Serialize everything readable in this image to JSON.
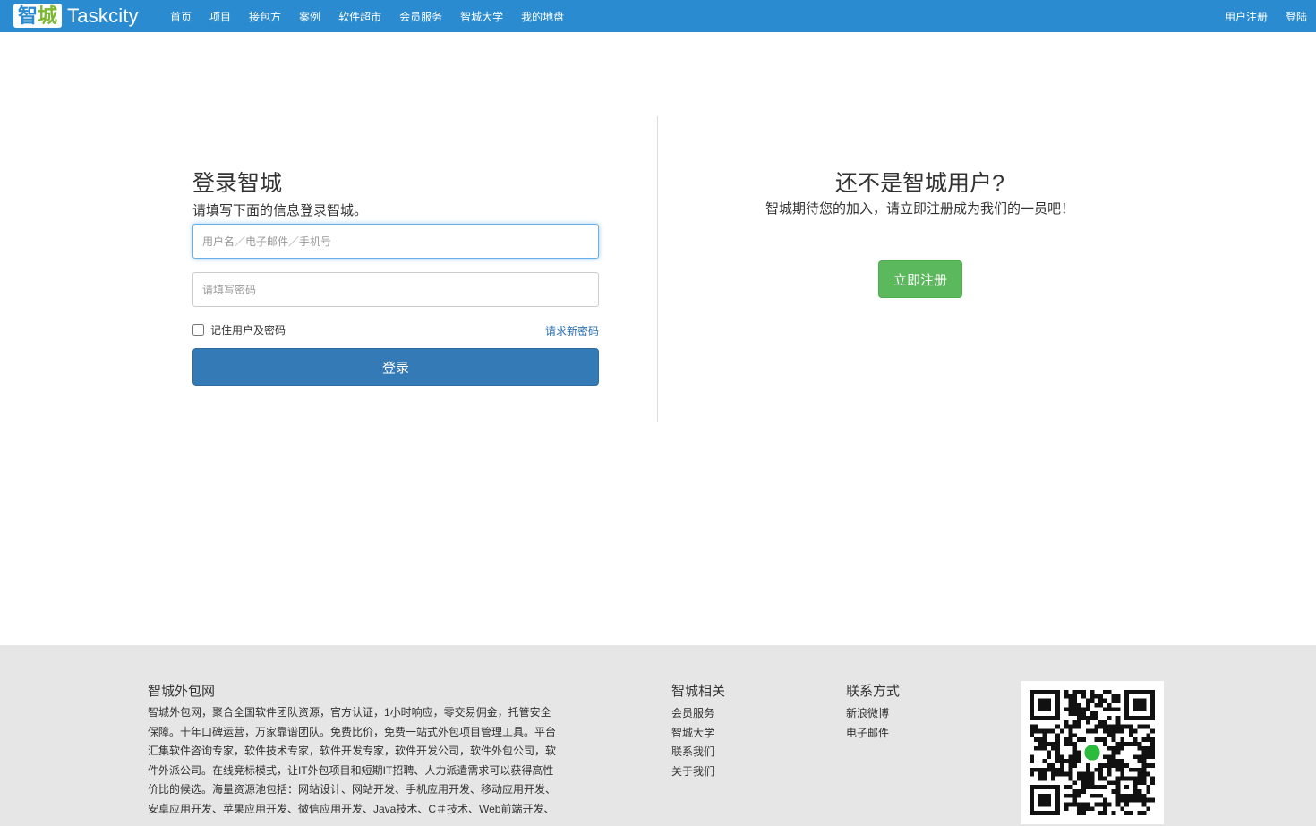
{
  "nav": {
    "logo_char1": "智",
    "logo_char2": "城",
    "logo_text": "Taskcity",
    "links": [
      "首页",
      "项目",
      "接包方",
      "案例",
      "软件超市",
      "会员服务",
      "智城大学",
      "我的地盘"
    ],
    "register": "用户注册",
    "login": "登陆"
  },
  "login": {
    "title": "登录智城",
    "subtitle": "请填写下面的信息登录智城。",
    "username_placeholder": "用户名／电子邮件／手机号",
    "password_placeholder": "请填写密码",
    "remember_label": "记住用户及密码",
    "forgot_link": "请求新密码",
    "submit": "登录"
  },
  "register": {
    "title": "还不是智城用户?",
    "subtitle": "智城期待您的加入，请立即注册成为我们的一员吧！",
    "button": "立即注册"
  },
  "footer": {
    "about_title": "智城外包网",
    "about_text": "智城外包网，聚合全国软件团队资源，官方认证，1小时响应，零交易佣金，托管安全保障。十年口碑运营，万家靠谱团队。免费比价，免费一站式外包项目管理工具。平台汇集软件咨询专家，软件技术专家，软件开发专家，软件开发公司，软件外包公司，软件外派公司。在线竞标模式，让IT外包项目和短期IT招聘、人力派遣需求可以获得高性价比的候选。海量资源池包括：网站设计、网站开发、手机应用开发、移动应用开发、安卓应用开发、苹果应用开发、微信应用开发、Java技术、C＃技术、Web前端开发、",
    "related_title": "智城相关",
    "related_links": [
      "会员服务",
      "智城大学",
      "联系我们",
      "关于我们"
    ],
    "contact_title": "联系方式",
    "contact_links": [
      "新浪微博",
      "电子邮件"
    ]
  },
  "colors": {
    "nav_bg": "#2a8bd0",
    "primary_btn": "#337ab7",
    "success_btn": "#5cb85c",
    "footer_bg": "#e6e6e6"
  }
}
